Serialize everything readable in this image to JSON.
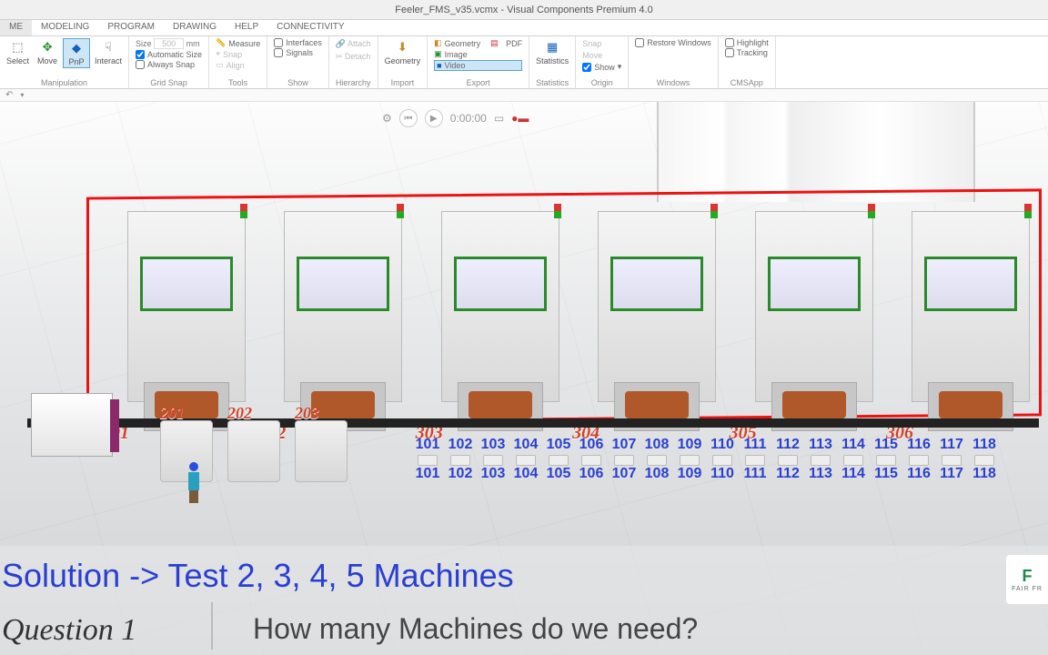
{
  "title": "Feeler_FMS_v35.vcmx - Visual Components Premium 4.0",
  "tabs": {
    "me": "ME",
    "modeling": "MODELING",
    "program": "PROGRAM",
    "drawing": "DRAWING",
    "help": "HELP",
    "connectivity": "CONNECTIVITY"
  },
  "ribbon": {
    "manipulation": {
      "label": "Manipulation",
      "select": "Select",
      "move": "Move",
      "pnp": "PnP",
      "interact": "Interact"
    },
    "gridsnap": {
      "label": "Grid Snap",
      "size": "Size",
      "sizeval": "500",
      "unit": "mm",
      "auto": "Automatic Size",
      "always": "Always Snap"
    },
    "tools": {
      "label": "Tools",
      "measure": "Measure",
      "snap": "Snap",
      "align": "Align"
    },
    "show": {
      "label": "Show",
      "interfaces": "Interfaces",
      "signals": "Signals"
    },
    "hierarchy": {
      "label": "Hierarchy",
      "attach": "Attach",
      "detach": "Detach"
    },
    "import": {
      "label": "Import",
      "geometry": "Geometry"
    },
    "export": {
      "label": "Export",
      "geometry": "Geometry",
      "pdf": "PDF",
      "image": "Image",
      "video": "Video"
    },
    "statistics": {
      "label": "Statistics",
      "statistics": "Statistics"
    },
    "origin": {
      "label": "Origin",
      "snap": "Snap",
      "move": "Move",
      "show": "Show"
    },
    "windows": {
      "label": "Windows",
      "restore": "Restore Windows"
    },
    "cmsapp": {
      "label": "CMSApp",
      "highlight": "Highlight",
      "tracking": "Tracking"
    }
  },
  "sim": {
    "time": "0:00:00"
  },
  "machines": [
    "301",
    "302",
    "303",
    "304",
    "305",
    "306"
  ],
  "units200": [
    "201",
    "202",
    "203"
  ],
  "row100": [
    "101",
    "102",
    "103",
    "104",
    "105",
    "106",
    "107",
    "108",
    "109",
    "110",
    "111",
    "112",
    "113",
    "114",
    "115",
    "116",
    "117",
    "118"
  ],
  "overlay": {
    "solution": "Solution -> Test 2, 3, 4, 5 Machines",
    "question_label": "Question 1",
    "question_text": "How many Machines do we need?"
  },
  "logo": {
    "text": "F",
    "sub": "FAIR FR"
  }
}
